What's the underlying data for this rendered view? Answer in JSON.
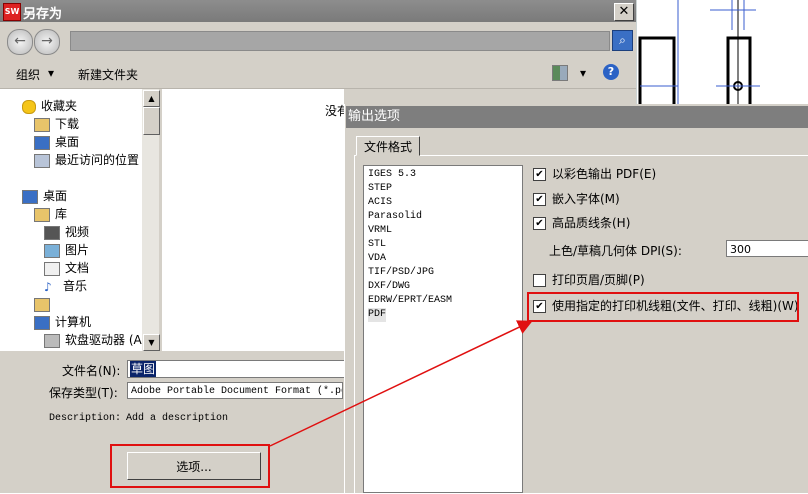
{
  "save_as": {
    "title": "另存为",
    "app_icon": "SW",
    "close": "✕",
    "toolbar": {
      "organize": "组织",
      "new_folder": "新建文件夹"
    },
    "nav_items": [
      {
        "label": "收藏夹",
        "icon": "star-icon",
        "indent": 22
      },
      {
        "label": "下载",
        "icon": "download-folder-icon",
        "indent": 34
      },
      {
        "label": "桌面",
        "icon": "desktop-icon",
        "indent": 34
      },
      {
        "label": "最近访问的位置",
        "icon": "recent-places-icon",
        "indent": 34
      },
      {
        "label": "桌面",
        "icon": "desktop-icon",
        "indent": 22
      },
      {
        "label": "库",
        "icon": "library-icon",
        "indent": 34
      },
      {
        "label": "视频",
        "icon": "video-icon",
        "indent": 44
      },
      {
        "label": "图片",
        "icon": "picture-icon",
        "indent": 44
      },
      {
        "label": "文档",
        "icon": "document-icon",
        "indent": 44
      },
      {
        "label": "音乐",
        "icon": "music-icon",
        "indent": 44
      },
      {
        "label": "",
        "icon": "user-folder-icon",
        "indent": 34
      },
      {
        "label": "计算机",
        "icon": "computer-icon",
        "indent": 34
      },
      {
        "label": "软盘驱动器 (A",
        "icon": "floppy-drive-icon",
        "indent": 44
      }
    ],
    "empty_text": "没有",
    "filename_label": "文件名(N):",
    "filename_value": "草图",
    "filetype_label": "保存类型(T):",
    "filetype_value": "Adobe Portable Document Format (*.pdf)",
    "description_label": "Description:",
    "description_value": "Add a description",
    "options_button": "选项..."
  },
  "output_options": {
    "title": "输出选项",
    "tab": "文件格式",
    "formats": [
      "IGES 5.3",
      "STEP",
      "ACIS",
      "Parasolid",
      "VRML",
      "STL",
      "VDA",
      "TIF/PSD/JPG",
      "DXF/DWG",
      "EDRW/EPRT/EASM",
      "PDF"
    ],
    "selected_format": "PDF",
    "checkboxes": [
      {
        "label": "以彩色输出 PDF(E)",
        "checked": true
      },
      {
        "label": "嵌入字体(M)",
        "checked": true
      },
      {
        "label": "高品质线条(H)",
        "checked": true
      },
      {
        "label": "打印页眉/页脚(P)",
        "checked": false
      },
      {
        "label": "使用指定的打印机线粗(文件、打印、线粗)(W)",
        "checked": true
      }
    ],
    "dpi_label": "上色/草稿几何体 DPI(S):",
    "dpi_value": "300"
  },
  "colors": {
    "highlight": "#e01010",
    "dialog_bg": "#d4d0c8",
    "title_bg": "#7e7e7e"
  }
}
